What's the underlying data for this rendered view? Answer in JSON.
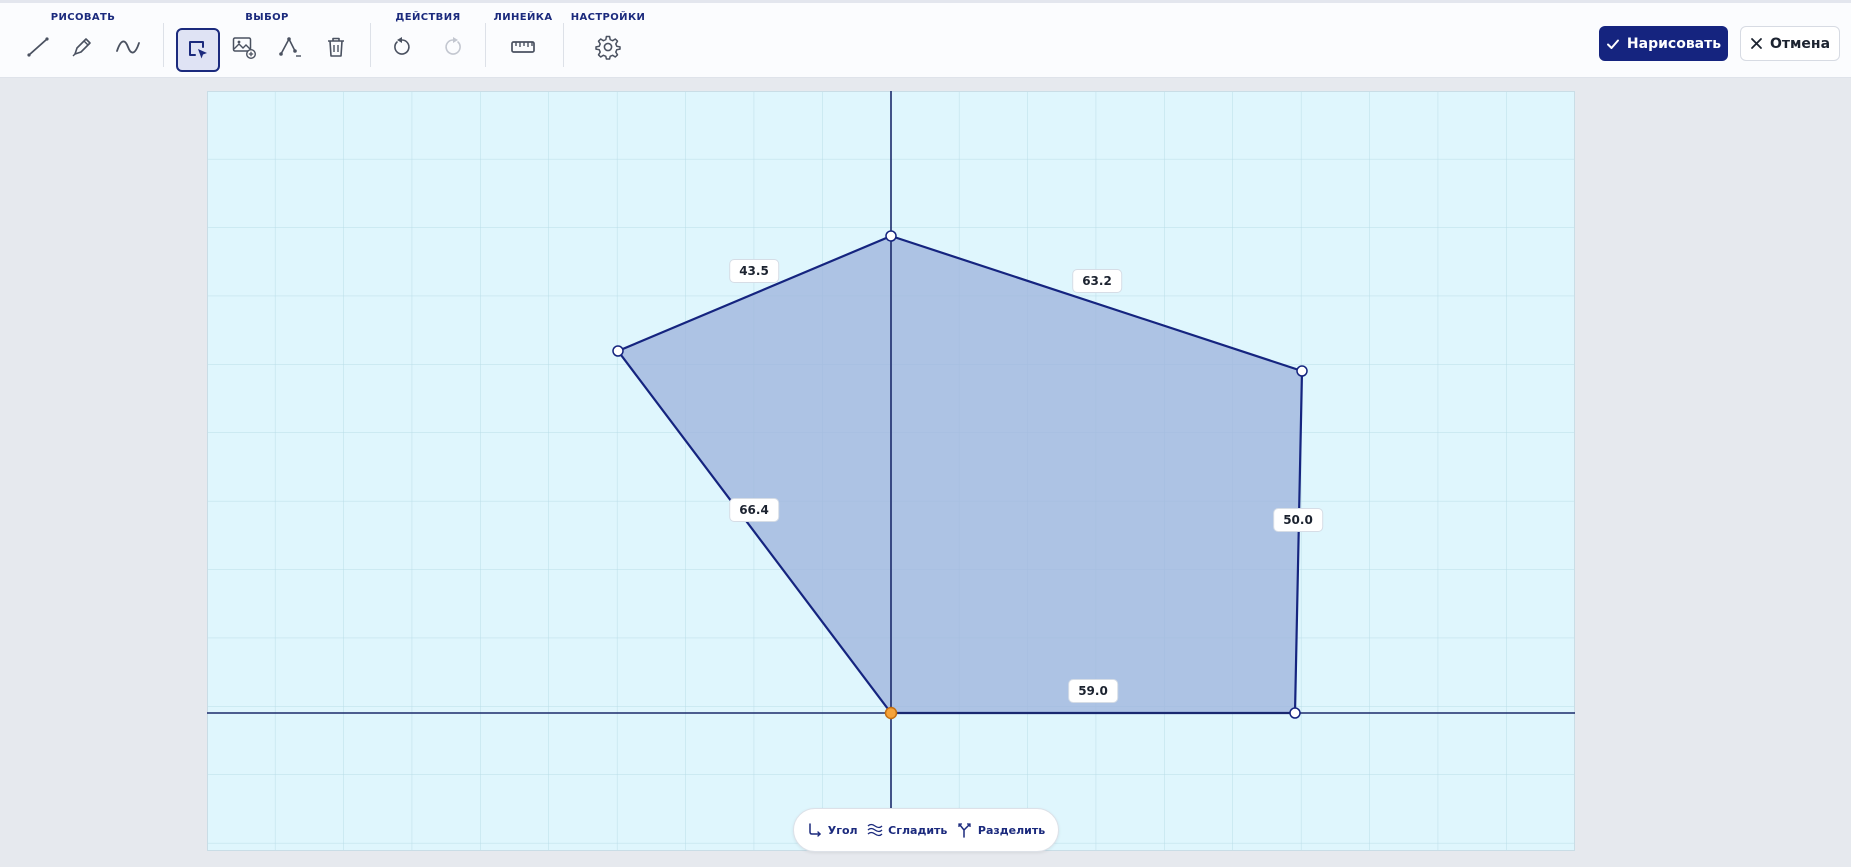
{
  "toolbar": {
    "groups": {
      "draw": "РИСОВАТЬ",
      "select": "ВЫБОР",
      "actions": "ДЕЙСТВИЯ",
      "ruler": "ЛИНЕЙКА",
      "settings": "НАСТРОЙКИ"
    },
    "draw_tools": [
      "line-icon",
      "pen-icon",
      "curve-icon"
    ],
    "select_tools": [
      "select-area-icon",
      "image-add-icon",
      "vertex-edit-icon",
      "trash-icon"
    ],
    "active_tool": "select-area-icon",
    "action_tools": [
      "undo-icon",
      "redo-icon"
    ],
    "ruler_tool": "ruler-icon",
    "settings_tool": "gear-icon",
    "confirm_label": "Нарисовать",
    "cancel_label": "Отмена"
  },
  "canvas": {
    "measurements": [
      "43.5",
      "63.2",
      "50.0",
      "59.0",
      "66.4"
    ]
  },
  "bottom_bar": {
    "corner_label": "Угол",
    "smooth_label": "Сгладить",
    "split_label": "Разделить"
  },
  "colors": {
    "accent": "#15247f",
    "canvas_bg": "#dff6fd",
    "polygon_fill": "#9fb5dc",
    "origin_point": "#f5a33a"
  }
}
